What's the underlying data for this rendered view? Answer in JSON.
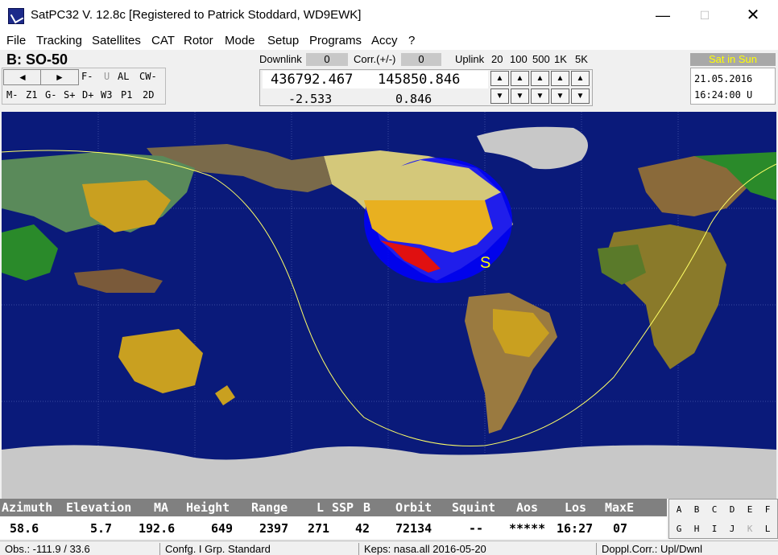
{
  "window": {
    "title": "SatPC32 V. 12.8c   [Registered to Patrick Stoddard, WD9EWK]",
    "minimize": "—",
    "maximize": "☐",
    "close": "✕"
  },
  "menu": [
    "File",
    "Tracking",
    "Satellites",
    "CAT",
    "Rotor",
    "Mode",
    "Setup",
    "Programs",
    "Accy",
    "?"
  ],
  "satellite": {
    "name": "B: SO-50"
  },
  "controls": {
    "prev": "◄",
    "next": "►",
    "opts_row1": [
      "F-",
      "U",
      "AL",
      "CW-"
    ],
    "opts_row2": [
      "M-",
      "Z1",
      "G-",
      "S+",
      "D+",
      "W3",
      "P1",
      "2D"
    ]
  },
  "freq": {
    "downlink_label": "Downlink",
    "downlink_corr": "0",
    "corr_label": "Corr.(+/-)",
    "corr_value": "0",
    "uplink_label": "Uplink",
    "steps": [
      "20",
      "100",
      "500",
      "1K",
      "5K"
    ],
    "downlink": "436792.467",
    "uplink": "145850.846",
    "downlink_doppler": "-2.533",
    "uplink_doppler": "0.846"
  },
  "status_badge": "Sat in Sun",
  "datetime": {
    "date": "21.05.2016",
    "time": "16:24:00 U"
  },
  "map": {
    "sat_marker": "S",
    "colors": {
      "ocean": "#0a1a7a",
      "footprint": "#0000ff",
      "track": "#ffff66"
    }
  },
  "data_headers": [
    "Azimuth",
    "Elevation",
    "MA",
    "Height",
    "Range",
    "L",
    "SSP",
    "B",
    "Orbit",
    "Squint",
    "Aos",
    "Los",
    "MaxE"
  ],
  "data_values": [
    "58.6",
    "5.7",
    "192.6",
    "649",
    "2397",
    "271",
    "42",
    "72134",
    "--",
    "*****",
    "16:27",
    "07"
  ],
  "letters_row1": [
    "A",
    "B",
    "C",
    "D",
    "E",
    "F"
  ],
  "letters_row2": [
    "G",
    "H",
    "I",
    "J",
    "K",
    "L"
  ],
  "statusbar": {
    "obs": "Obs.: -111.9 / 33.6",
    "config": "Confg. I  Grp. Standard",
    "keps": "Keps: nasa.all 2016-05-20",
    "doppler": "Doppl.Corr.: Upl/Dwnl"
  }
}
